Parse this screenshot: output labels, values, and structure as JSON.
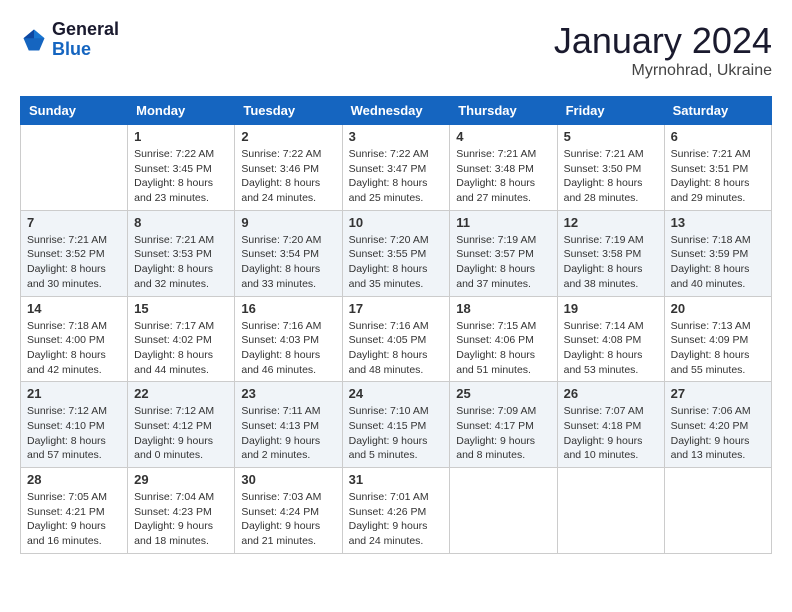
{
  "logo": {
    "line1": "General",
    "line2": "Blue"
  },
  "header": {
    "month": "January 2024",
    "location": "Myrnohrad, Ukraine"
  },
  "weekdays": [
    "Sunday",
    "Monday",
    "Tuesday",
    "Wednesday",
    "Thursday",
    "Friday",
    "Saturday"
  ],
  "weeks": [
    [
      {
        "day": "",
        "content": ""
      },
      {
        "day": "1",
        "content": "Sunrise: 7:22 AM\nSunset: 3:45 PM\nDaylight: 8 hours\nand 23 minutes."
      },
      {
        "day": "2",
        "content": "Sunrise: 7:22 AM\nSunset: 3:46 PM\nDaylight: 8 hours\nand 24 minutes."
      },
      {
        "day": "3",
        "content": "Sunrise: 7:22 AM\nSunset: 3:47 PM\nDaylight: 8 hours\nand 25 minutes."
      },
      {
        "day": "4",
        "content": "Sunrise: 7:21 AM\nSunset: 3:48 PM\nDaylight: 8 hours\nand 27 minutes."
      },
      {
        "day": "5",
        "content": "Sunrise: 7:21 AM\nSunset: 3:50 PM\nDaylight: 8 hours\nand 28 minutes."
      },
      {
        "day": "6",
        "content": "Sunrise: 7:21 AM\nSunset: 3:51 PM\nDaylight: 8 hours\nand 29 minutes."
      }
    ],
    [
      {
        "day": "7",
        "content": "Sunrise: 7:21 AM\nSunset: 3:52 PM\nDaylight: 8 hours\nand 30 minutes."
      },
      {
        "day": "8",
        "content": "Sunrise: 7:21 AM\nSunset: 3:53 PM\nDaylight: 8 hours\nand 32 minutes."
      },
      {
        "day": "9",
        "content": "Sunrise: 7:20 AM\nSunset: 3:54 PM\nDaylight: 8 hours\nand 33 minutes."
      },
      {
        "day": "10",
        "content": "Sunrise: 7:20 AM\nSunset: 3:55 PM\nDaylight: 8 hours\nand 35 minutes."
      },
      {
        "day": "11",
        "content": "Sunrise: 7:19 AM\nSunset: 3:57 PM\nDaylight: 8 hours\nand 37 minutes."
      },
      {
        "day": "12",
        "content": "Sunrise: 7:19 AM\nSunset: 3:58 PM\nDaylight: 8 hours\nand 38 minutes."
      },
      {
        "day": "13",
        "content": "Sunrise: 7:18 AM\nSunset: 3:59 PM\nDaylight: 8 hours\nand 40 minutes."
      }
    ],
    [
      {
        "day": "14",
        "content": "Sunrise: 7:18 AM\nSunset: 4:00 PM\nDaylight: 8 hours\nand 42 minutes."
      },
      {
        "day": "15",
        "content": "Sunrise: 7:17 AM\nSunset: 4:02 PM\nDaylight: 8 hours\nand 44 minutes."
      },
      {
        "day": "16",
        "content": "Sunrise: 7:16 AM\nSunset: 4:03 PM\nDaylight: 8 hours\nand 46 minutes."
      },
      {
        "day": "17",
        "content": "Sunrise: 7:16 AM\nSunset: 4:05 PM\nDaylight: 8 hours\nand 48 minutes."
      },
      {
        "day": "18",
        "content": "Sunrise: 7:15 AM\nSunset: 4:06 PM\nDaylight: 8 hours\nand 51 minutes."
      },
      {
        "day": "19",
        "content": "Sunrise: 7:14 AM\nSunset: 4:08 PM\nDaylight: 8 hours\nand 53 minutes."
      },
      {
        "day": "20",
        "content": "Sunrise: 7:13 AM\nSunset: 4:09 PM\nDaylight: 8 hours\nand 55 minutes."
      }
    ],
    [
      {
        "day": "21",
        "content": "Sunrise: 7:12 AM\nSunset: 4:10 PM\nDaylight: 8 hours\nand 57 minutes."
      },
      {
        "day": "22",
        "content": "Sunrise: 7:12 AM\nSunset: 4:12 PM\nDaylight: 9 hours\nand 0 minutes."
      },
      {
        "day": "23",
        "content": "Sunrise: 7:11 AM\nSunset: 4:13 PM\nDaylight: 9 hours\nand 2 minutes."
      },
      {
        "day": "24",
        "content": "Sunrise: 7:10 AM\nSunset: 4:15 PM\nDaylight: 9 hours\nand 5 minutes."
      },
      {
        "day": "25",
        "content": "Sunrise: 7:09 AM\nSunset: 4:17 PM\nDaylight: 9 hours\nand 8 minutes."
      },
      {
        "day": "26",
        "content": "Sunrise: 7:07 AM\nSunset: 4:18 PM\nDaylight: 9 hours\nand 10 minutes."
      },
      {
        "day": "27",
        "content": "Sunrise: 7:06 AM\nSunset: 4:20 PM\nDaylight: 9 hours\nand 13 minutes."
      }
    ],
    [
      {
        "day": "28",
        "content": "Sunrise: 7:05 AM\nSunset: 4:21 PM\nDaylight: 9 hours\nand 16 minutes."
      },
      {
        "day": "29",
        "content": "Sunrise: 7:04 AM\nSunset: 4:23 PM\nDaylight: 9 hours\nand 18 minutes."
      },
      {
        "day": "30",
        "content": "Sunrise: 7:03 AM\nSunset: 4:24 PM\nDaylight: 9 hours\nand 21 minutes."
      },
      {
        "day": "31",
        "content": "Sunrise: 7:01 AM\nSunset: 4:26 PM\nDaylight: 9 hours\nand 24 minutes."
      },
      {
        "day": "",
        "content": ""
      },
      {
        "day": "",
        "content": ""
      },
      {
        "day": "",
        "content": ""
      }
    ]
  ]
}
